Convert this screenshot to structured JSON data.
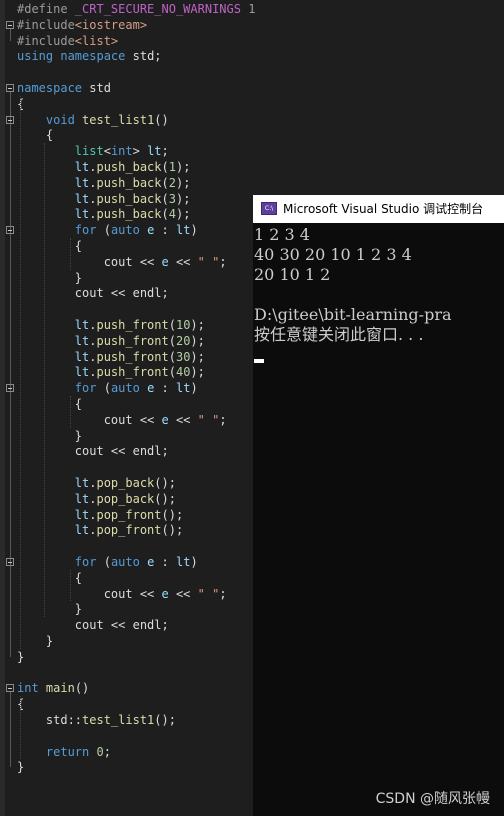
{
  "colors": {
    "editor_bg": "#1e1e1e",
    "text": "#dcdcdc",
    "keyword": "#569cd6",
    "preprocessor": "#9b9b9b",
    "macro": "#bd63c5",
    "string": "#d69d85",
    "type": "#4ec9b0",
    "function": "#dcdcaa",
    "number": "#b5cea8",
    "variable": "#9cdcfe",
    "console_bg": "#0c0c0c",
    "console_text": "#cccccc"
  },
  "editor": {
    "lines": [
      [
        {
          "t": "#define ",
          "c": "preprocessor"
        },
        {
          "t": "_CRT_SECURE_NO_WARNINGS",
          "c": "macro"
        },
        {
          "t": " 1",
          "c": "preprocessor"
        }
      ],
      [
        {
          "t": "#include",
          "c": "preprocessor"
        },
        {
          "t": "<iostream>",
          "c": "string"
        }
      ],
      [
        {
          "t": "#include",
          "c": "preprocessor"
        },
        {
          "t": "<list>",
          "c": "string"
        }
      ],
      [
        {
          "t": "using",
          "c": "keyword"
        },
        {
          "t": " ",
          "c": "text"
        },
        {
          "t": "namespace",
          "c": "keyword"
        },
        {
          "t": " std;",
          "c": "text"
        }
      ],
      [],
      [
        {
          "t": "namespace",
          "c": "keyword"
        },
        {
          "t": " std",
          "c": "text"
        }
      ],
      [
        {
          "t": "{",
          "c": "text"
        }
      ],
      [
        {
          "t": "    ",
          "c": "text"
        },
        {
          "t": "void",
          "c": "keyword"
        },
        {
          "t": " ",
          "c": "text"
        },
        {
          "t": "test_list1",
          "c": "function"
        },
        {
          "t": "()",
          "c": "text"
        }
      ],
      [
        {
          "t": "    {",
          "c": "text"
        }
      ],
      [
        {
          "t": "        ",
          "c": "text"
        },
        {
          "t": "list",
          "c": "type"
        },
        {
          "t": "<",
          "c": "text"
        },
        {
          "t": "int",
          "c": "keyword"
        },
        {
          "t": "> ",
          "c": "text"
        },
        {
          "t": "lt",
          "c": "variable"
        },
        {
          "t": ";",
          "c": "text"
        }
      ],
      [
        {
          "t": "        ",
          "c": "text"
        },
        {
          "t": "lt",
          "c": "variable"
        },
        {
          "t": ".",
          "c": "text"
        },
        {
          "t": "push_back",
          "c": "function"
        },
        {
          "t": "(",
          "c": "text"
        },
        {
          "t": "1",
          "c": "number"
        },
        {
          "t": ");",
          "c": "text"
        }
      ],
      [
        {
          "t": "        ",
          "c": "text"
        },
        {
          "t": "lt",
          "c": "variable"
        },
        {
          "t": ".",
          "c": "text"
        },
        {
          "t": "push_back",
          "c": "function"
        },
        {
          "t": "(",
          "c": "text"
        },
        {
          "t": "2",
          "c": "number"
        },
        {
          "t": ");",
          "c": "text"
        }
      ],
      [
        {
          "t": "        ",
          "c": "text"
        },
        {
          "t": "lt",
          "c": "variable"
        },
        {
          "t": ".",
          "c": "text"
        },
        {
          "t": "push_back",
          "c": "function"
        },
        {
          "t": "(",
          "c": "text"
        },
        {
          "t": "3",
          "c": "number"
        },
        {
          "t": ");",
          "c": "text"
        }
      ],
      [
        {
          "t": "        ",
          "c": "text"
        },
        {
          "t": "lt",
          "c": "variable"
        },
        {
          "t": ".",
          "c": "text"
        },
        {
          "t": "push_back",
          "c": "function"
        },
        {
          "t": "(",
          "c": "text"
        },
        {
          "t": "4",
          "c": "number"
        },
        {
          "t": ");",
          "c": "text"
        }
      ],
      [
        {
          "t": "        ",
          "c": "text"
        },
        {
          "t": "for",
          "c": "keyword"
        },
        {
          "t": " (",
          "c": "text"
        },
        {
          "t": "auto",
          "c": "keyword"
        },
        {
          "t": " ",
          "c": "text"
        },
        {
          "t": "e",
          "c": "variable"
        },
        {
          "t": " : ",
          "c": "text"
        },
        {
          "t": "lt",
          "c": "variable"
        },
        {
          "t": ")",
          "c": "text"
        }
      ],
      [
        {
          "t": "        {",
          "c": "text"
        }
      ],
      [
        {
          "t": "            cout << ",
          "c": "text"
        },
        {
          "t": "e",
          "c": "variable"
        },
        {
          "t": " << ",
          "c": "text"
        },
        {
          "t": "\" \"",
          "c": "string"
        },
        {
          "t": ";",
          "c": "text"
        }
      ],
      [
        {
          "t": "        }",
          "c": "text"
        }
      ],
      [
        {
          "t": "        cout << endl;",
          "c": "text"
        }
      ],
      [],
      [
        {
          "t": "        ",
          "c": "text"
        },
        {
          "t": "lt",
          "c": "variable"
        },
        {
          "t": ".",
          "c": "text"
        },
        {
          "t": "push_front",
          "c": "function"
        },
        {
          "t": "(",
          "c": "text"
        },
        {
          "t": "10",
          "c": "number"
        },
        {
          "t": ");",
          "c": "text"
        }
      ],
      [
        {
          "t": "        ",
          "c": "text"
        },
        {
          "t": "lt",
          "c": "variable"
        },
        {
          "t": ".",
          "c": "text"
        },
        {
          "t": "push_front",
          "c": "function"
        },
        {
          "t": "(",
          "c": "text"
        },
        {
          "t": "20",
          "c": "number"
        },
        {
          "t": ");",
          "c": "text"
        }
      ],
      [
        {
          "t": "        ",
          "c": "text"
        },
        {
          "t": "lt",
          "c": "variable"
        },
        {
          "t": ".",
          "c": "text"
        },
        {
          "t": "push_front",
          "c": "function"
        },
        {
          "t": "(",
          "c": "text"
        },
        {
          "t": "30",
          "c": "number"
        },
        {
          "t": ");",
          "c": "text"
        }
      ],
      [
        {
          "t": "        ",
          "c": "text"
        },
        {
          "t": "lt",
          "c": "variable"
        },
        {
          "t": ".",
          "c": "text"
        },
        {
          "t": "push_front",
          "c": "function"
        },
        {
          "t": "(",
          "c": "text"
        },
        {
          "t": "40",
          "c": "number"
        },
        {
          "t": ");",
          "c": "text"
        }
      ],
      [
        {
          "t": "        ",
          "c": "text"
        },
        {
          "t": "for",
          "c": "keyword"
        },
        {
          "t": " (",
          "c": "text"
        },
        {
          "t": "auto",
          "c": "keyword"
        },
        {
          "t": " ",
          "c": "text"
        },
        {
          "t": "e",
          "c": "variable"
        },
        {
          "t": " : ",
          "c": "text"
        },
        {
          "t": "lt",
          "c": "variable"
        },
        {
          "t": ")",
          "c": "text"
        }
      ],
      [
        {
          "t": "        {",
          "c": "text"
        }
      ],
      [
        {
          "t": "            cout << ",
          "c": "text"
        },
        {
          "t": "e",
          "c": "variable"
        },
        {
          "t": " << ",
          "c": "text"
        },
        {
          "t": "\" \"",
          "c": "string"
        },
        {
          "t": ";",
          "c": "text"
        }
      ],
      [
        {
          "t": "        }",
          "c": "text"
        }
      ],
      [
        {
          "t": "        cout << endl;",
          "c": "text"
        }
      ],
      [],
      [
        {
          "t": "        ",
          "c": "text"
        },
        {
          "t": "lt",
          "c": "variable"
        },
        {
          "t": ".",
          "c": "text"
        },
        {
          "t": "pop_back",
          "c": "function"
        },
        {
          "t": "();",
          "c": "text"
        }
      ],
      [
        {
          "t": "        ",
          "c": "text"
        },
        {
          "t": "lt",
          "c": "variable"
        },
        {
          "t": ".",
          "c": "text"
        },
        {
          "t": "pop_back",
          "c": "function"
        },
        {
          "t": "();",
          "c": "text"
        }
      ],
      [
        {
          "t": "        ",
          "c": "text"
        },
        {
          "t": "lt",
          "c": "variable"
        },
        {
          "t": ".",
          "c": "text"
        },
        {
          "t": "pop_front",
          "c": "function"
        },
        {
          "t": "();",
          "c": "text"
        }
      ],
      [
        {
          "t": "        ",
          "c": "text"
        },
        {
          "t": "lt",
          "c": "variable"
        },
        {
          "t": ".",
          "c": "text"
        },
        {
          "t": "pop_front",
          "c": "function"
        },
        {
          "t": "();",
          "c": "text"
        }
      ],
      [],
      [
        {
          "t": "        ",
          "c": "text"
        },
        {
          "t": "for",
          "c": "keyword"
        },
        {
          "t": " (",
          "c": "text"
        },
        {
          "t": "auto",
          "c": "keyword"
        },
        {
          "t": " ",
          "c": "text"
        },
        {
          "t": "e",
          "c": "variable"
        },
        {
          "t": " : ",
          "c": "text"
        },
        {
          "t": "lt",
          "c": "variable"
        },
        {
          "t": ")",
          "c": "text"
        }
      ],
      [
        {
          "t": "        {",
          "c": "text"
        }
      ],
      [
        {
          "t": "            cout << ",
          "c": "text"
        },
        {
          "t": "e",
          "c": "variable"
        },
        {
          "t": " << ",
          "c": "text"
        },
        {
          "t": "\" \"",
          "c": "string"
        },
        {
          "t": ";",
          "c": "text"
        }
      ],
      [
        {
          "t": "        }",
          "c": "text"
        }
      ],
      [
        {
          "t": "        cout << endl;",
          "c": "text"
        }
      ],
      [
        {
          "t": "    }",
          "c": "text"
        }
      ],
      [
        {
          "t": "}",
          "c": "text"
        }
      ],
      [],
      [
        {
          "t": "int",
          "c": "keyword"
        },
        {
          "t": " ",
          "c": "text"
        },
        {
          "t": "main",
          "c": "function"
        },
        {
          "t": "()",
          "c": "text"
        }
      ],
      [
        {
          "t": "{",
          "c": "text"
        }
      ],
      [
        {
          "t": "    std::",
          "c": "text"
        },
        {
          "t": "test_list1",
          "c": "function"
        },
        {
          "t": "();",
          "c": "text"
        }
      ],
      [],
      [
        {
          "t": "    ",
          "c": "text"
        },
        {
          "t": "return",
          "c": "keyword"
        },
        {
          "t": " ",
          "c": "text"
        },
        {
          "t": "0",
          "c": "number"
        },
        {
          "t": ";",
          "c": "text"
        }
      ],
      [
        {
          "t": "}",
          "c": "text"
        }
      ]
    ]
  },
  "console": {
    "title": "Microsoft Visual Studio 调试控制台",
    "icon": "visual-studio-console-icon",
    "output_lines": [
      "1 2 3 4",
      "40 30 20 10 1 2 3 4",
      "20 10 1 2",
      "",
      "D:\\gitee\\bit-learning-pra",
      "按任意键关闭此窗口. . ."
    ]
  },
  "watermark": "CSDN @随风张幔"
}
